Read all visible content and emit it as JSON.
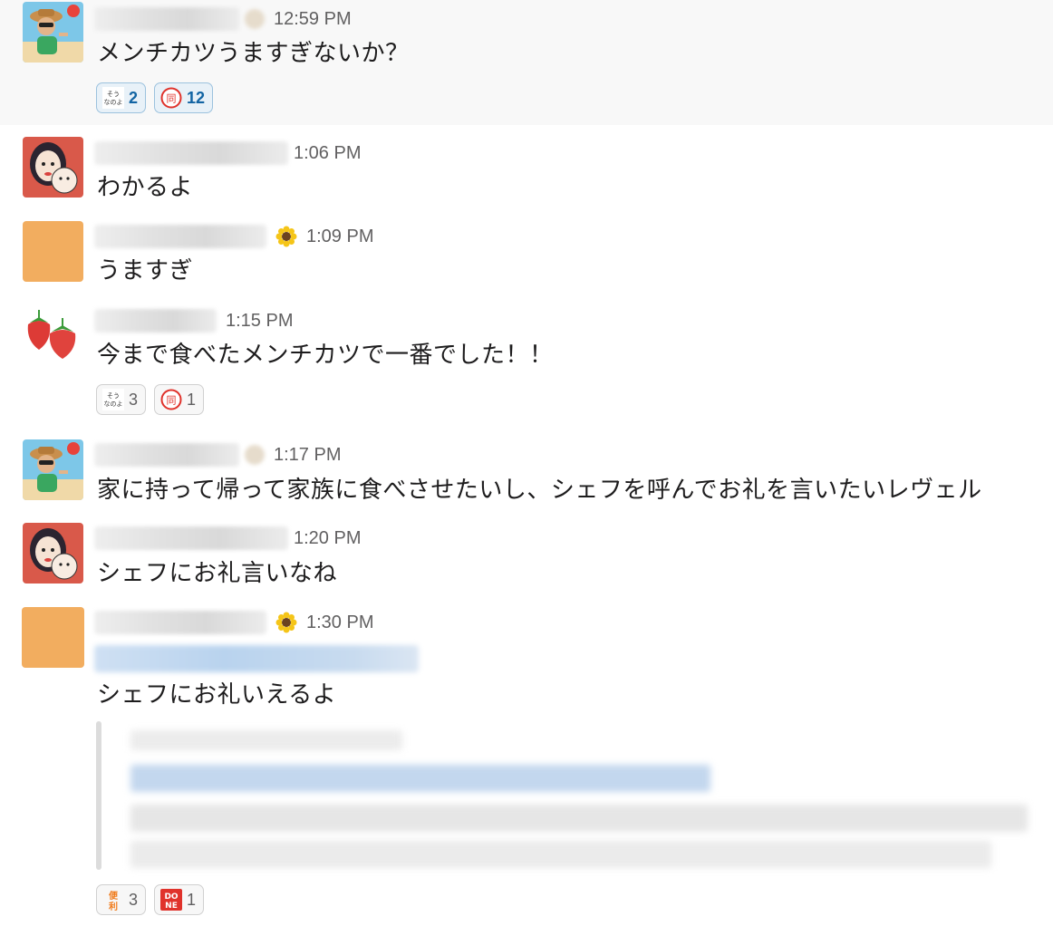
{
  "messages": [
    {
      "time": "12:59 PM",
      "text": "メンチカツうますぎないか？",
      "reactions": [
        {
          "emoji": "sounanoyo-icon",
          "emoji_text": "そう なのよ",
          "count": "2"
        },
        {
          "emoji": "doui-stamp-icon",
          "emoji_text": "同意",
          "count": "12"
        }
      ]
    },
    {
      "time": "1:06 PM",
      "text": "わかるよ"
    },
    {
      "time": "1:09 PM",
      "text": "うますぎ",
      "status_emoji": "sunflower-icon"
    },
    {
      "time": "1:15 PM",
      "text": "今まで食べたメンチカツで一番でした！！",
      "reactions": [
        {
          "emoji": "sounanoyo-icon",
          "emoji_text": "そう なのよ",
          "count": "3"
        },
        {
          "emoji": "doui-stamp-icon",
          "emoji_text": "同意",
          "count": "1"
        }
      ]
    },
    {
      "time": "1:17 PM",
      "text": "家に持って帰って家族に食べさせたいし、シェフを呼んでお礼を言いたいレヴェル"
    },
    {
      "time": "1:20 PM",
      "text": "シェフにお礼言いなね"
    },
    {
      "time": "1:30 PM",
      "text": "シェフにお礼いえるよ",
      "status_emoji": "sunflower-icon",
      "reactions": [
        {
          "emoji": "benri-icon",
          "emoji_text": "便利",
          "count": "3"
        },
        {
          "emoji": "done-icon",
          "emoji_text": "DONE",
          "count": "1"
        }
      ]
    }
  ],
  "colors": {
    "accent_link": "#1264a3",
    "own_reaction_bg": "#e8f1f8",
    "avatar_orange": "#f2ad5f",
    "avatar_red": "#d9594a"
  }
}
